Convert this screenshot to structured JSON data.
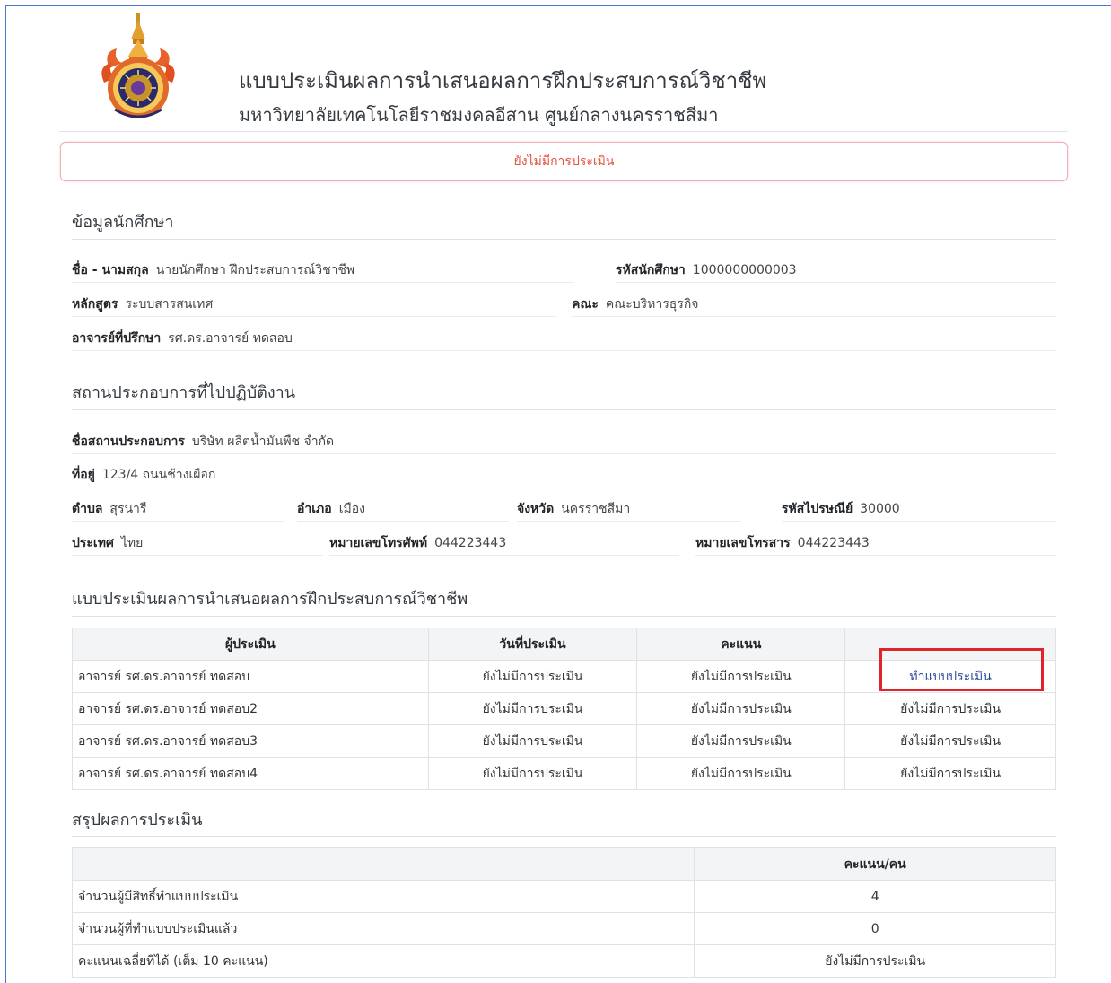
{
  "header": {
    "title": "แบบประเมินผลการนำเสนอผลการฝึกประสบการณ์วิชาชีพ",
    "subtitle": "มหาวิทยาลัยเทคโนโลยีราชมงคลอีสาน ศูนย์กลางนครราชสีมา"
  },
  "alert": {
    "text": "ยังไม่มีการประเมิน"
  },
  "student": {
    "section_title": "ข้อมูลนักศึกษา",
    "name_label": "ชื่อ - นามสกุล",
    "name_value": "นายนักศึกษา ฝึกประสบการณ์วิชาชีพ",
    "id_label": "รหัสนักศึกษา",
    "id_value": "1000000000003",
    "program_label": "หลักสูตร",
    "program_value": "ระบบสารสนเทศ",
    "faculty_label": "คณะ",
    "faculty_value": "คณะบริหารธุรกิจ",
    "advisor_label": "อาจารย์ที่ปรึกษา",
    "advisor_value": "รศ.ดร.อาจารย์ ทดสอบ"
  },
  "company": {
    "section_title": "สถานประกอบการที่ไปปฏิบัติงาน",
    "name_label": "ชื่อสถานประกอบการ",
    "name_value": "บริษัท ผลิตน้ำมันพืช จำกัด",
    "address_label": "ที่อยู่",
    "address_value": "123/4 ถนนช้างเผือก",
    "subdistrict_label": "ตำบล",
    "subdistrict_value": "สุรนารี",
    "district_label": "อำเภอ",
    "district_value": "เมือง",
    "province_label": "จังหวัด",
    "province_value": "นครราชสีมา",
    "postcode_label": "รหัสไปรษณีย์",
    "postcode_value": "30000",
    "country_label": "ประเทศ",
    "country_value": "ไทย",
    "phone_label": "หมายเลขโทรศัพท์",
    "phone_value": "044223443",
    "fax_label": "หมายเลขโทรสาร",
    "fax_value": "044223443"
  },
  "evaluation": {
    "section_title": "แบบประเมินผลการนำเสนอผลการฝึกประสบการณ์วิชาชีพ",
    "headers": [
      "ผู้ประเมิน",
      "วันที่ประเมิน",
      "คะแนน",
      ""
    ],
    "rows": [
      [
        "อาจารย์ รศ.ดร.อาจารย์ ทดสอบ",
        "ยังไม่มีการประเมิน",
        "ยังไม่มีการประเมิน",
        "ทำแบบประเมิน"
      ],
      [
        "อาจารย์ รศ.ดร.อาจารย์ ทดสอบ2",
        "ยังไม่มีการประเมิน",
        "ยังไม่มีการประเมิน",
        "ยังไม่มีการประเมิน"
      ],
      [
        "อาจารย์ รศ.ดร.อาจารย์ ทดสอบ3",
        "ยังไม่มีการประเมิน",
        "ยังไม่มีการประเมิน",
        "ยังไม่มีการประเมิน"
      ],
      [
        "อาจารย์ รศ.ดร.อาจารย์ ทดสอบ4",
        "ยังไม่มีการประเมิน",
        "ยังไม่มีการประเมิน",
        "ยังไม่มีการประเมิน"
      ]
    ]
  },
  "summary": {
    "section_title": "สรุปผลการประเมิน",
    "headers": [
      "",
      "คะแนน/คน"
    ],
    "rows": [
      [
        "จำนวนผู้มีสิทธิ์ทำแบบประเมิน",
        "4"
      ],
      [
        "จำนวนผู้ที่ทำแบบประเมินแล้ว",
        "0"
      ],
      [
        "คะแนนเฉลี่ยที่ได้ (เต็ม 10 คะแนน)",
        "ยังไม่มีการประเมิน"
      ]
    ]
  },
  "colors": {
    "alert_text": "#e0533f",
    "alert_border": "#f1b0b7",
    "link": "#2c4a9a",
    "highlight": "#e0242b",
    "table_header_bg": "#f2f4f6"
  }
}
